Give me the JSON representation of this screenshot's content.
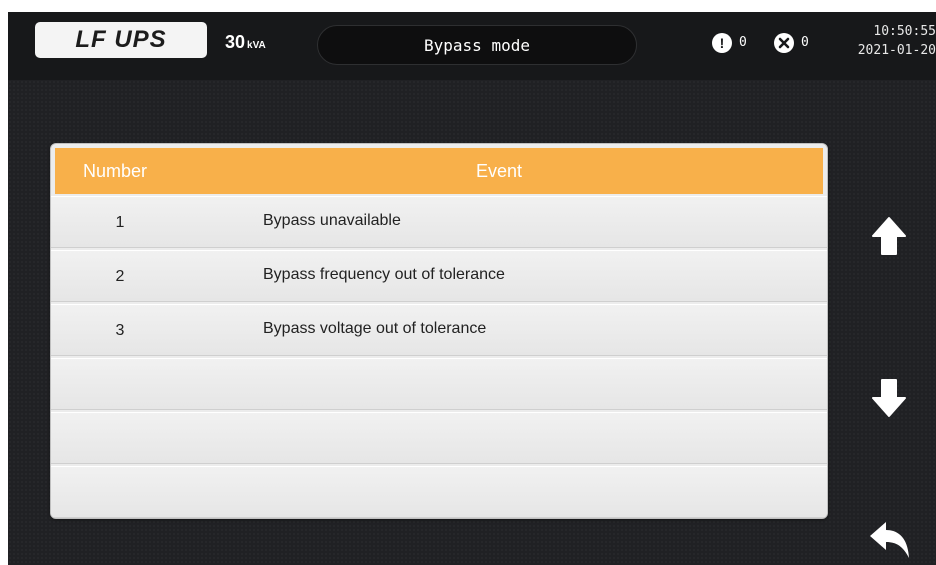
{
  "header": {
    "logo_text": "LF UPS",
    "capacity_value": "30",
    "capacity_unit": "kVA",
    "mode": "Bypass mode",
    "warning_count": "0",
    "fault_count": "0",
    "time": "10:50:55",
    "date": "2021-01-20"
  },
  "table": {
    "columns": [
      "Number",
      "Event"
    ],
    "rows": [
      {
        "number": "1",
        "event": "Bypass unavailable"
      },
      {
        "number": "2",
        "event": "Bypass frequency out of tolerance"
      },
      {
        "number": "3",
        "event": "Bypass voltage  out of tolerance"
      },
      {
        "number": "",
        "event": ""
      },
      {
        "number": "",
        "event": ""
      },
      {
        "number": "",
        "event": ""
      }
    ]
  },
  "icons": {
    "warning": "exclamation-circle-icon",
    "fault": "x-circle-icon",
    "page_up": "arrow-up-icon",
    "page_down": "arrow-down-icon",
    "back": "back-arrow-icon"
  },
  "colors": {
    "accent": "#f8b04a",
    "background": "#202124",
    "topbar": "#17181a"
  }
}
